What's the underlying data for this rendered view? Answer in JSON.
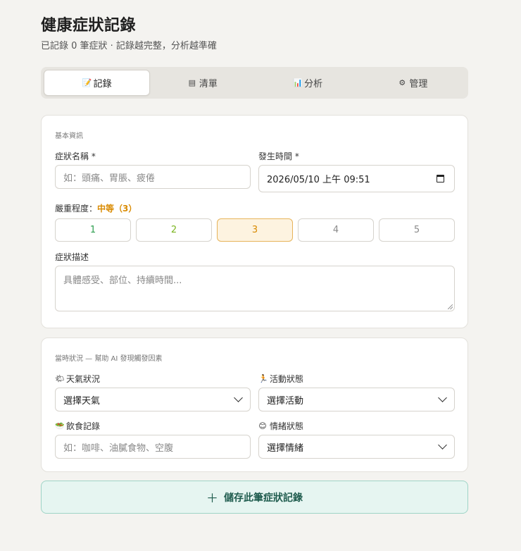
{
  "header": {
    "title": "健康症狀記錄",
    "subtitle": "已記錄 0 筆症狀 · 記錄越完整，分析越準確"
  },
  "tabs": [
    {
      "label": "記錄",
      "icon": "memo-icon",
      "glyph": "📝",
      "active": true
    },
    {
      "label": "清單",
      "icon": "list-icon",
      "glyph": "▤",
      "active": false
    },
    {
      "label": "分析",
      "icon": "bar-chart-icon",
      "glyph": "📊",
      "active": false
    },
    {
      "label": "管理",
      "icon": "gear-icon",
      "glyph": "⚙",
      "active": false
    }
  ],
  "basic": {
    "section_label": "基本資訊",
    "symptom_name_label": "症狀名稱 *",
    "symptom_name_placeholder": "如：頭痛、胃脹、疲倦",
    "time_label": "發生時間 *",
    "time_value": "2026/05/10 上午 09:51",
    "severity_label": "嚴重程度：",
    "severity_value_text": "中等（3）",
    "severity_options": [
      {
        "label": "1",
        "color": "#2e9e4f"
      },
      {
        "label": "2",
        "color": "#7bb520"
      },
      {
        "label": "3",
        "color": "#d98a00"
      },
      {
        "label": "4",
        "color": "#8a8a8a"
      },
      {
        "label": "5",
        "color": "#8a8a8a"
      }
    ],
    "severity_selected": 3,
    "description_label": "症狀描述",
    "description_placeholder": "具體感受、部位、持續時間..."
  },
  "context": {
    "section_label": "當時狀況 — 幫助 AI 發現觸發因素",
    "weather_label": "天氣狀況",
    "weather_glyph": "🌤",
    "weather_value": "選擇天氣",
    "activity_label": "活動狀態",
    "activity_glyph": "🏃",
    "activity_value": "選擇活動",
    "diet_label": "飲食記錄",
    "diet_glyph": "🥗",
    "diet_placeholder": "如：咖啡、油膩食物、空腹",
    "mood_label": "情緒狀態",
    "mood_glyph": "😊",
    "mood_value": "選擇情緒"
  },
  "save_button": {
    "icon": "plus-icon",
    "glyph": "＋",
    "label": "儲存此筆症狀記錄"
  }
}
